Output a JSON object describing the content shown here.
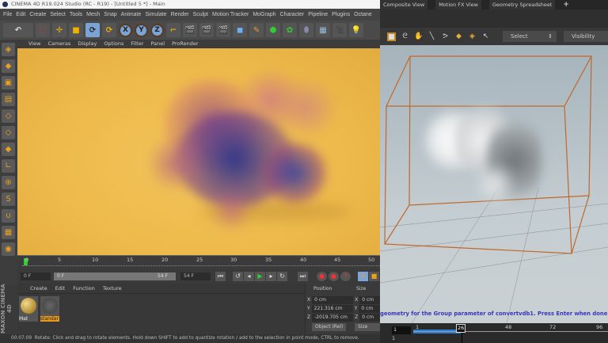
{
  "c4d": {
    "title": "CINEMA 4D R19.024 Studio (RC - R19) - [Untitled 5 *] - Main",
    "menu": [
      "File",
      "Edit",
      "Create",
      "Select",
      "Tools",
      "Mesh",
      "Snap",
      "Animate",
      "Simulate",
      "Render",
      "Sculpt",
      "Motion Tracker",
      "MoGraph",
      "Character",
      "Pipeline",
      "Plugins",
      "Octane"
    ],
    "axis_buttons": [
      "X",
      "Y",
      "Z"
    ],
    "viewport_menu": [
      "View",
      "Cameras",
      "Display",
      "Options",
      "Filter",
      "Panel",
      "ProRender"
    ],
    "timeline_ticks": [
      "0",
      "5",
      "10",
      "15",
      "20",
      "25",
      "30",
      "35",
      "40",
      "45",
      "50"
    ],
    "current_frame": "0 F",
    "range_start": "0 F",
    "range_end": "54 F",
    "end_frame": "54 F",
    "material_menu": [
      "Create",
      "Edit",
      "Function",
      "Texture"
    ],
    "materials": [
      {
        "name": "Mat"
      },
      {
        "name": "standar"
      }
    ],
    "coords": {
      "position_header": "Position",
      "size_header": "Size",
      "rows": [
        {
          "axis": "X",
          "pos": "0 cm",
          "size": "0 cm"
        },
        {
          "axis": "Y",
          "pos": "221.316 cm",
          "size": "0 cm"
        },
        {
          "axis": "Z",
          "pos": "-2019.705 cm",
          "size": "0 cm"
        }
      ],
      "mode": "Object (Rel)",
      "size_mode": "Size"
    },
    "brand": "MAXON CINEMA 4D",
    "status_time": "00:07:09",
    "status_text": "Rotate: Click and drag to rotate elements. Hold down SHIFT to add to quantize rotation / add to the selection in point mode, CTRL to remove.",
    "viewport_bg": "#edb94a"
  },
  "houdini": {
    "tabs": [
      "Composite View",
      "Motion FX View",
      "Geometry Spreadsheet"
    ],
    "add_tab": "+",
    "select_label": "Select",
    "visibility_label": "Visibility",
    "message": "geometry for the Group parameter of convertvdb1. Press Enter when done.",
    "timeline": {
      "start": "1",
      "current": "26",
      "ticks": [
        "1",
        "48",
        "72",
        "96"
      ],
      "field": "1",
      "field2": "1"
    },
    "bbox_color": "#c0682a",
    "playbar_color": "#2f7fd6"
  }
}
